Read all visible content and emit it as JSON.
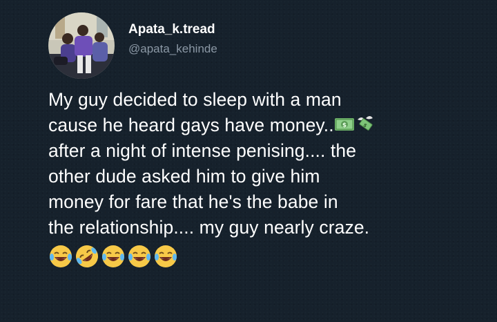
{
  "user": {
    "display_name": "Apata_k.tread",
    "handle": "@apata_kehinde"
  },
  "tweet": {
    "lines": [
      "My guy decided to sleep with a man",
      "cause he heard gays have money..",
      "after a night of intense penising.... the",
      "other dude asked him to give him",
      "money for fare that he's the babe in",
      "the relationship.... my guy nearly craze."
    ],
    "line2_emojis": [
      "dollar-banknote-emoji",
      "money-with-wings-emoji"
    ],
    "reaction_emojis": [
      "face-with-tears-of-joy-emoji",
      "rolling-on-the-floor-laughing-emoji",
      "face-with-tears-of-joy-emoji",
      "face-with-tears-of-joy-emoji",
      "face-with-tears-of-joy-emoji"
    ]
  },
  "colors": {
    "background": "#16212c",
    "text": "#ffffff",
    "handle": "#8b98a5"
  }
}
